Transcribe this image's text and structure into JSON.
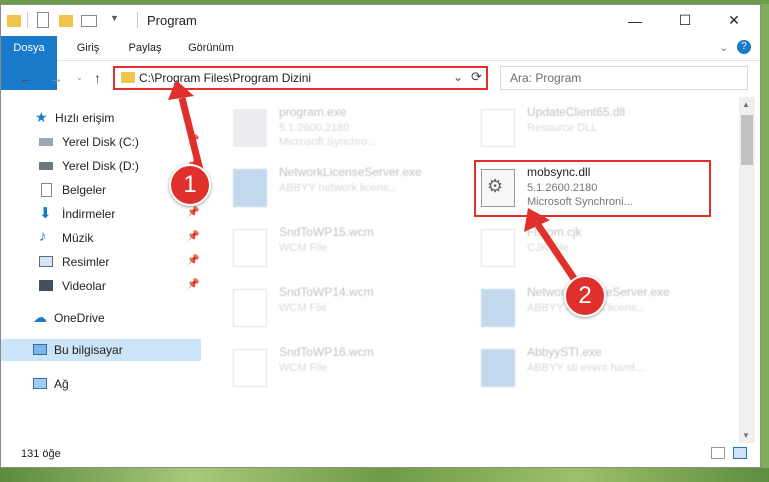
{
  "window": {
    "title": "Program",
    "controls": {
      "minimize": "—",
      "maximize": "☐",
      "close": "✕"
    }
  },
  "ribbon": {
    "tabs": [
      "Dosya",
      "Giriş",
      "Paylaş",
      "Görünüm"
    ],
    "help": "?"
  },
  "nav": {
    "back": "←",
    "forward": "→",
    "up": "↑",
    "address": "C:\\Program Files\\Program Dizini",
    "search_placeholder": "Ara: Program"
  },
  "sidebar": {
    "items": [
      {
        "label": "Hızlı erişim",
        "icon": "star-icon"
      },
      {
        "label": "Yerel Disk (C:)",
        "icon": "drive-icon",
        "pinned": true
      },
      {
        "label": "Yerel Disk (D:)",
        "icon": "drive-icon",
        "pinned": true
      },
      {
        "label": "Belgeler",
        "icon": "document-icon",
        "pinned": true
      },
      {
        "label": "İndirmeler",
        "icon": "download-icon",
        "pinned": true
      },
      {
        "label": "Müzik",
        "icon": "music-icon",
        "pinned": true
      },
      {
        "label": "Resimler",
        "icon": "picture-icon",
        "pinned": true
      },
      {
        "label": "Videolar",
        "icon": "video-icon",
        "pinned": true
      },
      {
        "label": "OneDrive",
        "icon": "cloud-icon"
      },
      {
        "label": "Bu bilgisayar",
        "icon": "computer-icon",
        "selected": true
      },
      {
        "label": "Ağ",
        "icon": "network-icon"
      }
    ]
  },
  "files": [
    {
      "name": "program.exe",
      "line1": "5.1.2600.2180",
      "line2": "Microsoft Synchro..."
    },
    {
      "name": "UpdateClient65.dll",
      "line1": "Resource DLL",
      "line2": ""
    },
    {
      "name": "NetworkLicenseServer.exe",
      "line1": "ABBYY network licens...",
      "line2": ""
    },
    {
      "name": "mobsync.dll",
      "line1": "5.1.2600.2180",
      "line2": "Microsoft Synchroni..."
    },
    {
      "name": "SndToWP15.wcm",
      "line1": "WCM File",
      "line2": ""
    },
    {
      "name": "Fi...om.cjk",
      "line1": "CJK File",
      "line2": ""
    },
    {
      "name": "SndToWP14.wcm",
      "line1": "WCM File",
      "line2": ""
    },
    {
      "name": "NetworkLicenseServer.exe",
      "line1": "ABBYY network licens...",
      "line2": ""
    },
    {
      "name": "SndToWP16.wcm",
      "line1": "WCM File",
      "line2": ""
    },
    {
      "name": "AbbyySTI.exe",
      "line1": "ABBYY sti event hand...",
      "line2": ""
    }
  ],
  "status": {
    "count": "131 öğe"
  },
  "annotations": {
    "badge1": "1",
    "badge2": "2"
  },
  "colors": {
    "accent": "#1979ca",
    "highlight": "#e0302c"
  }
}
